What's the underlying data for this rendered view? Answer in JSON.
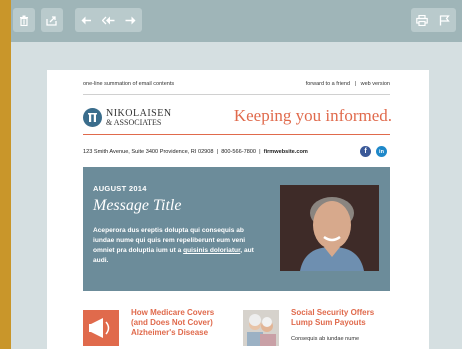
{
  "toolbar": {
    "left_buttons": [
      {
        "icon": "trash-icon"
      },
      {
        "icon": "move-to-folder-icon"
      },
      {
        "icon": "reply-icon"
      },
      {
        "icon": "reply-all-icon"
      },
      {
        "icon": "forward-icon"
      }
    ],
    "right_buttons": [
      {
        "icon": "print-icon"
      },
      {
        "icon": "flag-icon"
      }
    ]
  },
  "email": {
    "preheader": "one-line summation of email contents",
    "forward_link": "forward to a friend",
    "separator": "|",
    "web_version_link": "web version",
    "logo": {
      "line1": "NIKOLAISEN",
      "line2": "& ASSOCIATES"
    },
    "tagline": "Keeping you informed.",
    "address": "123 Smith Avenue, Suite 3400 Providence, RI 02908",
    "phone": "800-566-7800",
    "website": "firmwebsite.com",
    "social": [
      {
        "icon": "facebook-icon",
        "glyph": "f",
        "color": "#3b5998"
      },
      {
        "icon": "linkedin-icon",
        "glyph": "in",
        "color": "#1e88c9"
      }
    ],
    "hero": {
      "date": "AUGUST 2014",
      "title": "Message Title",
      "body_pre": "Aceperora dus ereptis dolupta qui consequis ab iundae nume qui quis rem repeliberunt eum veni omniet pra doluptia ium ut a ",
      "body_link": "quisinis doloriatur",
      "body_post": ", aut audi."
    },
    "articles": [
      {
        "title": "How Medicare Covers (and Does Not Cover) Alzheimer's Disease",
        "body": ""
      },
      {
        "title": "Social Security Offers Lump Sum Payouts",
        "body": "Consequis ab iundae nume"
      }
    ]
  },
  "colors": {
    "accent": "#e06a4c",
    "hero_bg": "#6c8c9a",
    "logo_blue": "#3a6d8c"
  }
}
